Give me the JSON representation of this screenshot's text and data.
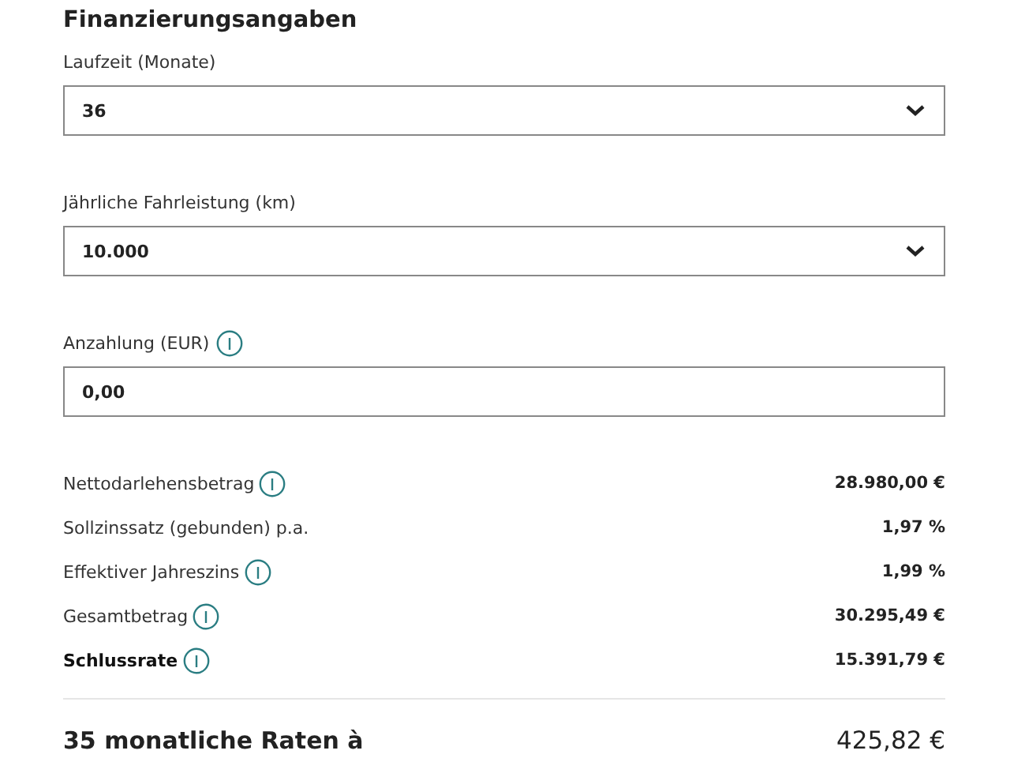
{
  "title": "Finanzierungsangaben",
  "fields": [
    {
      "label": "Laufzeit (Monate)",
      "info": false,
      "kind": "select",
      "value": "36"
    },
    {
      "label": "Jährliche Fahrleistung (km)",
      "info": false,
      "kind": "select",
      "value": "10.000"
    },
    {
      "label": "Anzahlung (EUR)",
      "info": true,
      "kind": "input",
      "value": "0,00"
    }
  ],
  "rows": [
    {
      "label": "Nettodarlehensbetrag",
      "info": true,
      "emphasized": false,
      "value": "28.980,00 €"
    },
    {
      "label": "Sollzinssatz (gebunden) p.a.",
      "info": false,
      "emphasized": false,
      "value": "1,97 %"
    },
    {
      "label": "Effektiver Jahreszins",
      "info": true,
      "emphasized": false,
      "value": "1,99 %"
    },
    {
      "label": "Gesamtbetrag",
      "info": true,
      "emphasized": false,
      "value": "30.295,49 €"
    },
    {
      "label": "Schlussrate",
      "info": true,
      "emphasized": true,
      "value": "15.391,79 €"
    }
  ],
  "total": {
    "label": "35 monatliche Raten à",
    "value": "425,82 €"
  }
}
